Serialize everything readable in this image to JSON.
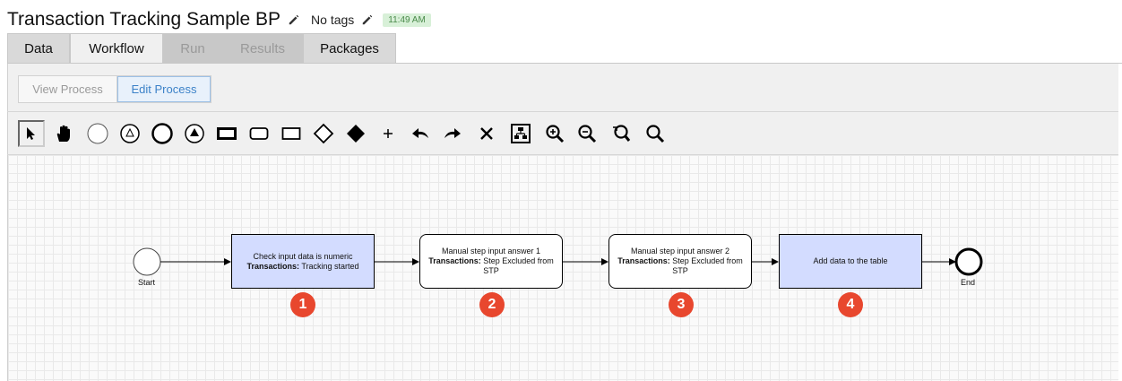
{
  "header": {
    "title": "Transaction Tracking Sample BP",
    "tags": "No tags",
    "time": "11:49 AM"
  },
  "tabs": [
    {
      "label": "Data",
      "state": "normal"
    },
    {
      "label": "Workflow",
      "state": "active"
    },
    {
      "label": "Run",
      "state": "disabled"
    },
    {
      "label": "Results",
      "state": "disabled"
    },
    {
      "label": "Packages",
      "state": "normal"
    }
  ],
  "view_toggle": {
    "view_label": "View Process",
    "edit_label": "Edit Process"
  },
  "toolbar": {
    "icons": [
      "pointer-icon",
      "hand-icon",
      "start-event-icon",
      "intermediate-event-icon",
      "end-event-icon",
      "terminate-event-icon",
      "task-icon",
      "rounded-task-icon",
      "subprocess-icon",
      "gateway-icon",
      "exclusive-gateway-icon",
      "plus-icon",
      "undo-icon",
      "redo-icon",
      "delete-icon",
      "layout-icon",
      "zoom-in-icon",
      "zoom-out-icon",
      "zoom-reset-icon",
      "zoom-fit-icon"
    ]
  },
  "diagram": {
    "start_label": "Start",
    "end_label": "End",
    "tasks": [
      {
        "line1": "Check input data is numeric",
        "bold": "Transactions:",
        "rest": " Tracking started",
        "highlight": true
      },
      {
        "line1": "Manual step input answer 1",
        "bold": "Transactions:",
        "rest": " Step Excluded from STP",
        "highlight": false
      },
      {
        "line1": "Manual step input answer 2",
        "bold": "Transactions:",
        "rest": " Step Excluded from STP",
        "highlight": false
      },
      {
        "line1": "Add data to the table",
        "bold": "",
        "rest": "",
        "highlight": true
      }
    ],
    "badges": [
      "1",
      "2",
      "3",
      "4"
    ]
  },
  "colors": {
    "badge": "#e8472e",
    "task_highlight": "#d3dcff",
    "edit_accent": "#3c82c8"
  }
}
